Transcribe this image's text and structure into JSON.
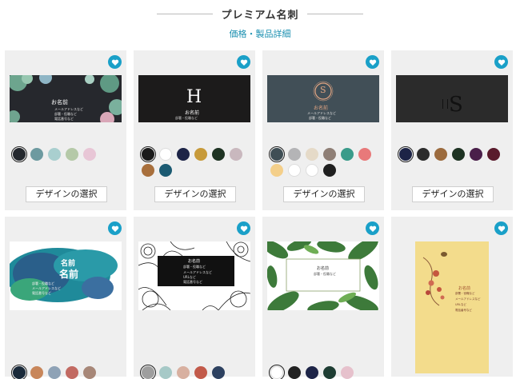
{
  "header": {
    "title": "プレミアム名刺",
    "link": "価格・製品詳細"
  },
  "cards": [
    {
      "button": "デザインの選択",
      "name": "お名前",
      "lines": [
        "メールアドレスなど",
        "部署・役職など",
        "電話番号など"
      ],
      "colors": [
        "#24282e",
        "#6d9aa0",
        "#a9cfcf",
        "#b5c9a8",
        "#e8c6d6"
      ]
    },
    {
      "button": "デザインの選択",
      "monogram": "H",
      "name": "お名前",
      "lines": [
        "部署・役職など"
      ],
      "colors": [
        "#1b1b1b",
        "#ffffff",
        "#1d2447",
        "#c79a3a",
        "#1e3323",
        "#c9b8be",
        "#a86f3c",
        "#1b5a72"
      ]
    },
    {
      "button": "デザインの選択",
      "monogram": "S",
      "name": "お名前",
      "lines": [
        "メールアドレスなど",
        "部署・役職など"
      ],
      "colors": [
        "#3f4e55",
        "#b4b4b6",
        "#e5dac8",
        "#8f7f76",
        "#3a9b8a",
        "#e8797a",
        "#f4cf8a",
        "#ffffff",
        "#ffffff",
        "#1f1f1f"
      ]
    },
    {
      "button": "デザインの選択",
      "monogram": "S",
      "colors": [
        "#1d2447",
        "#2c2c2c",
        "#9c6b3e",
        "#1e3323",
        "#4a1f4a",
        "#5a1b2c"
      ]
    },
    {
      "name": "名前",
      "sub": "名前",
      "lines": [
        "部署・役職など",
        "メールアドレスなど",
        "電話番号など"
      ],
      "colors": [
        "#1a2a3a",
        "#c8865a",
        "#8ea2b6",
        "#c26a62",
        "#a78778"
      ]
    },
    {
      "name": "お名前",
      "lines": [
        "部署・役職など",
        "メールアドレスなど",
        "URLなど",
        "電話番号など"
      ],
      "colors": [
        "#9e9e9e",
        "#a6c9c7",
        "#d8b0a0",
        "#c25a4a",
        "#2d4160"
      ]
    },
    {
      "name": "お名前",
      "lines": [
        "部署・役職など"
      ],
      "colors": [
        "#ffffff",
        "#222222",
        "#1d2447",
        "#1e3d33",
        "#e6c1cc"
      ]
    },
    {
      "name": "お名前",
      "lines": [
        "部署・役職など",
        "メールアドレスなど",
        "URLなど",
        "電話番号など"
      ]
    }
  ]
}
